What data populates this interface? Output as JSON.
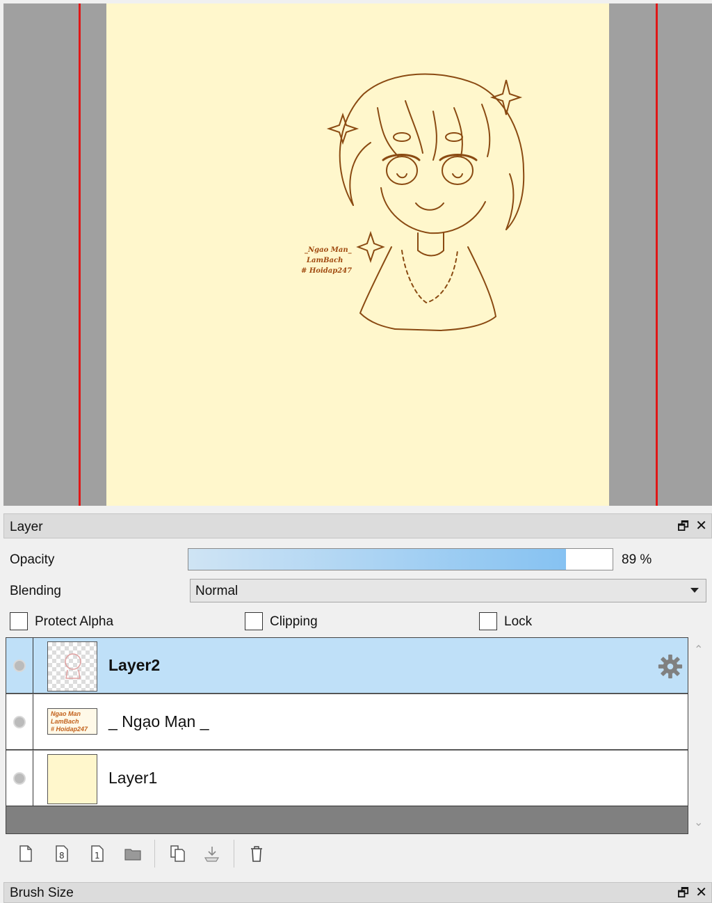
{
  "canvas": {
    "paper_color": "#fff7cc",
    "guide_color": "#e01818",
    "watermark_lines": [
      "_Ngao Man_",
      "LamBach",
      "# Hoidap247"
    ]
  },
  "layer_panel": {
    "title": "Layer",
    "float_icon": "restore-window-icon",
    "close_icon": "close-icon",
    "opacity_label": "Opacity",
    "opacity_value": "89 %",
    "opacity_fraction": 0.89,
    "blending_label": "Blending",
    "blending_value": "Normal",
    "protect_alpha_label": "Protect Alpha",
    "clipping_label": "Clipping",
    "lock_label": "Lock",
    "layers": [
      {
        "name": "Layer2",
        "selected": true,
        "thumb": "transparent-sketch"
      },
      {
        "name": "_ Ngạo Mạn _",
        "selected": false,
        "thumb": "text"
      },
      {
        "name": "Layer1",
        "selected": false,
        "thumb": "cream-fill"
      }
    ],
    "thumb_text": [
      "Ngao Man",
      "LamBach",
      "# Hoidap247"
    ],
    "toolbar_icons": [
      "new-layer-icon",
      "new-8bit-layer-icon",
      "new-1bit-layer-icon",
      "new-folder-icon",
      "duplicate-layer-icon",
      "merge-down-icon",
      "delete-layer-icon"
    ],
    "selected_color": "#bfe0f8"
  },
  "brush_panel": {
    "title": "Brush Size"
  }
}
